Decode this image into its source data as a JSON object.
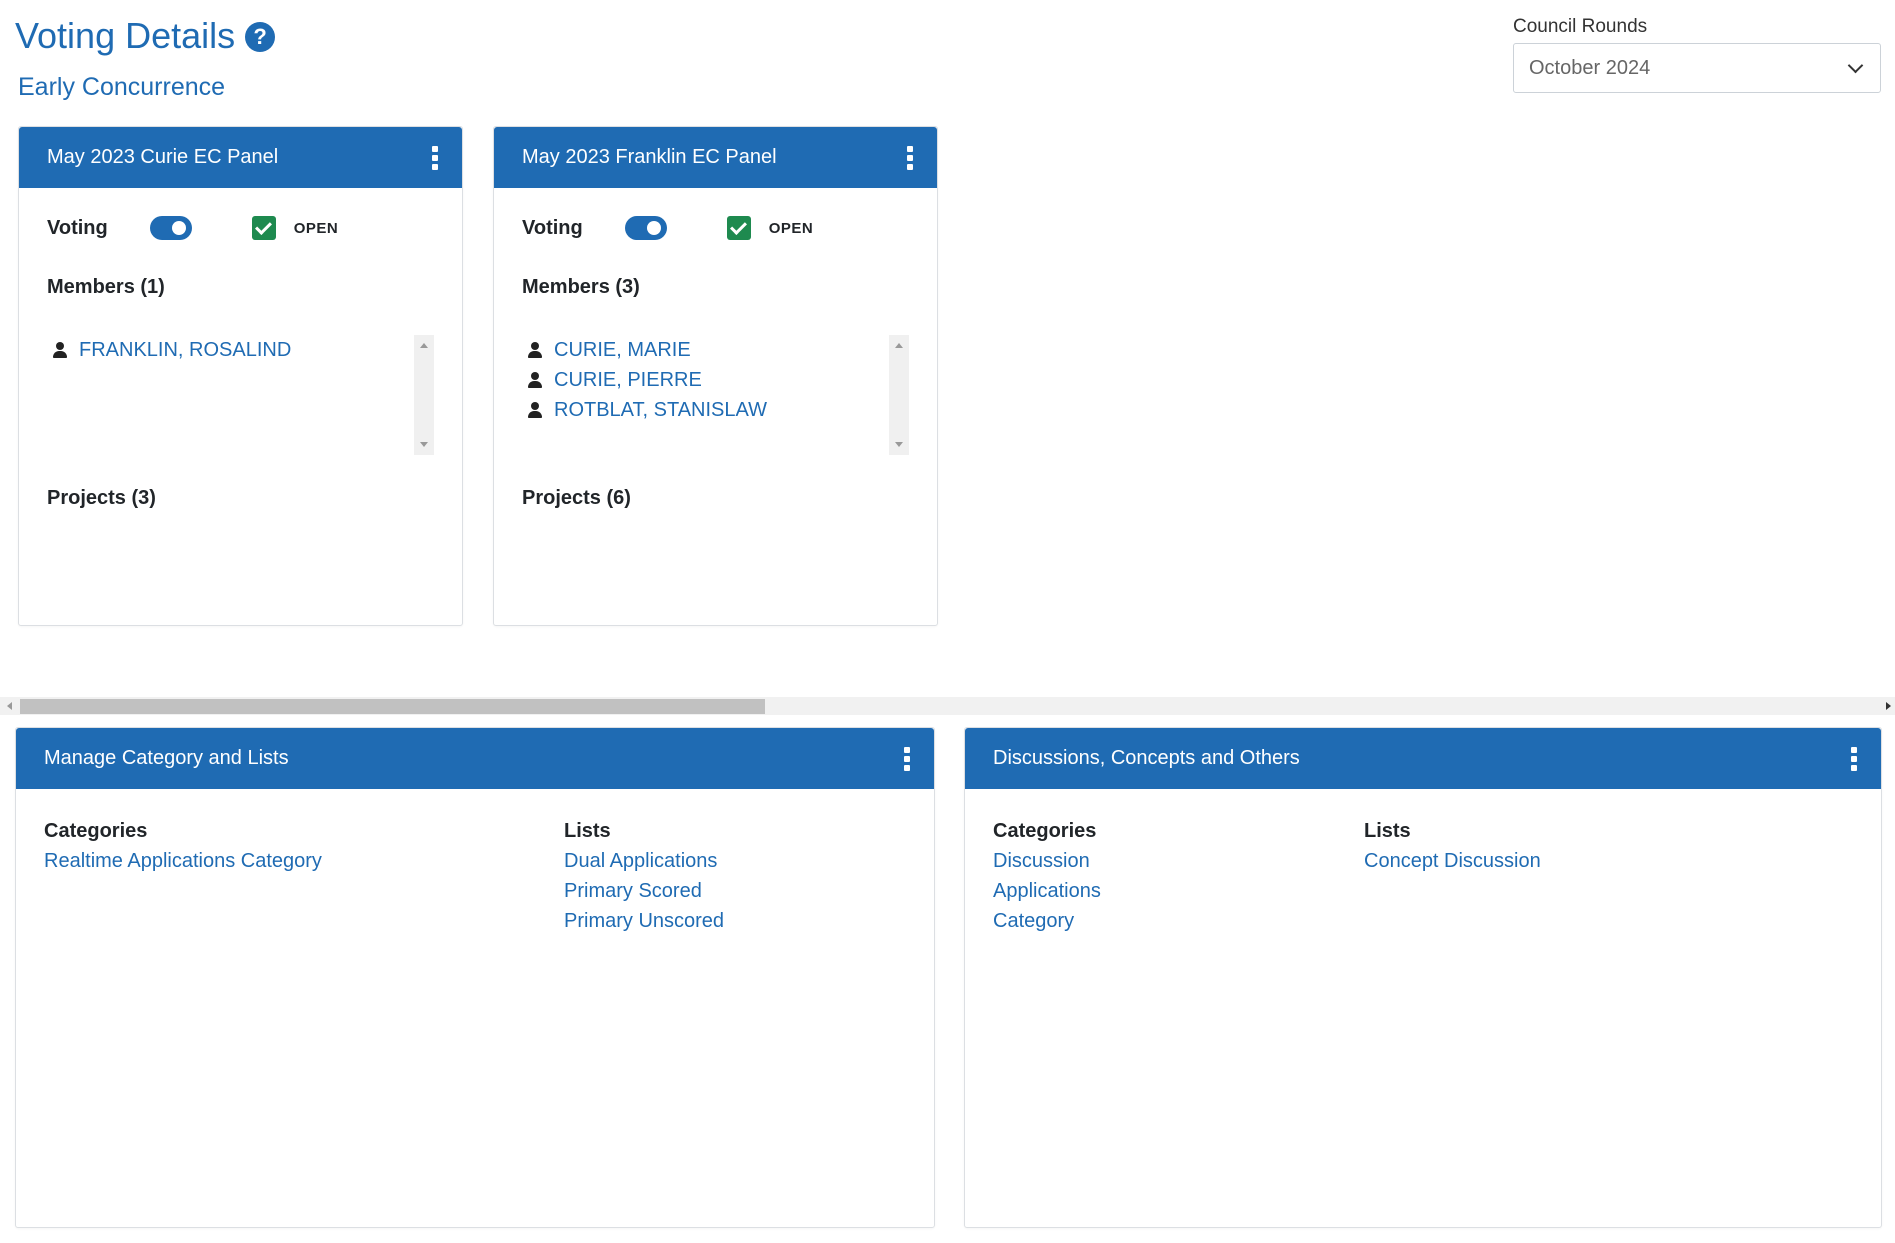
{
  "page": {
    "title": "Voting Details",
    "subtitle": "Early Concurrence",
    "help_icon": "question-circle-icon"
  },
  "council_rounds": {
    "label": "Council Rounds",
    "selected": "October 2024"
  },
  "panels": [
    {
      "title": "May 2023 Curie EC Panel",
      "voting_label": "Voting",
      "voting_on": true,
      "open_checked": true,
      "open_label": "OPEN",
      "members_title": "Members (1)",
      "members": [
        "FRANKLIN, ROSALIND"
      ],
      "projects_title": "Projects (3)"
    },
    {
      "title": "May 2023 Franklin EC Panel",
      "voting_label": "Voting",
      "voting_on": true,
      "open_checked": true,
      "open_label": "OPEN",
      "members_title": "Members (3)",
      "members": [
        "CURIE, MARIE",
        "CURIE, PIERRE",
        "ROTBLAT, STANISLAW"
      ],
      "projects_title": "Projects (6)"
    }
  ],
  "manage_category": {
    "title": "Manage Category and Lists",
    "categories_label": "Categories",
    "categories": [
      "Realtime Applications Category"
    ],
    "lists_label": "Lists",
    "lists": [
      "Dual Applications",
      "Primary Scored",
      "Primary Unscored"
    ]
  },
  "discussions": {
    "title": "Discussions, Concepts and Others",
    "categories_label": "Categories",
    "categories": [
      "Discussion",
      "Applications",
      "Category"
    ],
    "lists_label": "Lists",
    "lists": [
      "Concept Discussion"
    ]
  },
  "colors": {
    "primary": "#1f6bb3",
    "success": "#1e8a4f"
  }
}
